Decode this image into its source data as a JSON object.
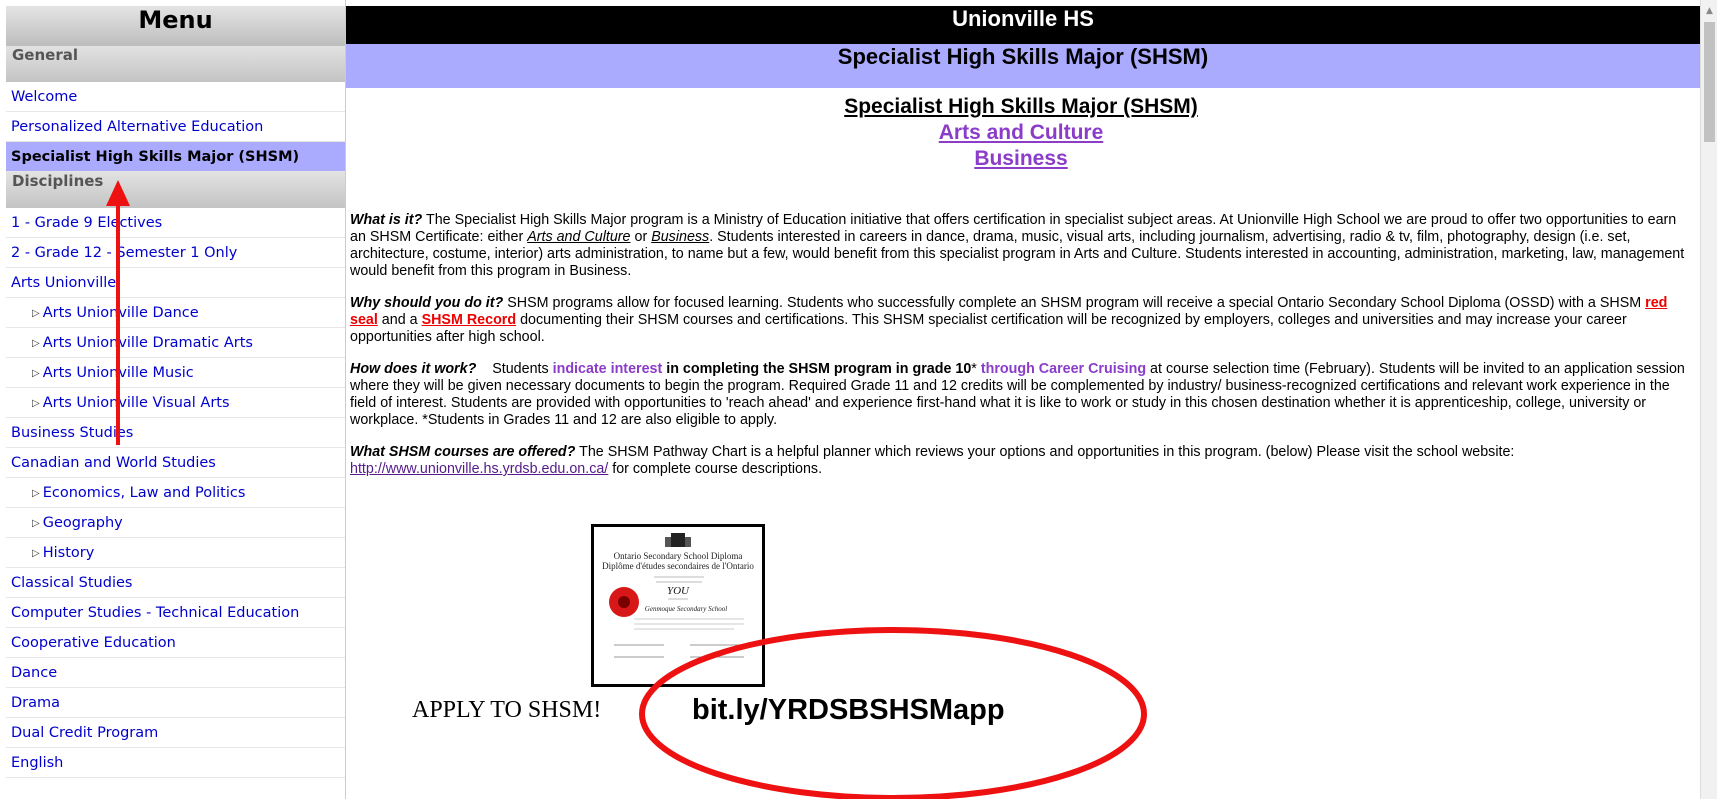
{
  "sidebar": {
    "title": "Menu",
    "general_heading": "General",
    "general_items": [
      {
        "label": "Welcome"
      },
      {
        "label": "Personalized Alternative Education"
      },
      {
        "label": "Specialist High Skills Major (SHSM)"
      }
    ],
    "disciplines_heading": "Disciplines",
    "discipline_items": [
      {
        "label": "1 - Grade 9 Electives"
      },
      {
        "label": "2 - Grade 12 - Semester 1 Only"
      },
      {
        "label": "Arts Unionville"
      },
      {
        "label": "Arts Unionville Dance"
      },
      {
        "label": "Arts Unionville Dramatic Arts"
      },
      {
        "label": "Arts Unionville Music"
      },
      {
        "label": "Arts Unionville Visual Arts"
      },
      {
        "label": "Business Studies"
      },
      {
        "label": "Canadian and World Studies"
      },
      {
        "label": "Economics, Law and Politics"
      },
      {
        "label": "Geography"
      },
      {
        "label": "History"
      },
      {
        "label": "Classical Studies"
      },
      {
        "label": "Computer Studies - Technical Education"
      },
      {
        "label": "Cooperative Education"
      },
      {
        "label": "Dance"
      },
      {
        "label": "Drama"
      },
      {
        "label": "Dual Credit Program"
      },
      {
        "label": "English"
      }
    ]
  },
  "header": {
    "school": "Unionville HS",
    "page_title": "Specialist High Skills Major (SHSM)"
  },
  "content": {
    "heading": "Specialist High Skills Major (SHSM)",
    "link_arts": "Arts and Culture",
    "link_business": "Business",
    "p1": {
      "q": "What is it?",
      "t1": " The Specialist High Skills Major program is a  Ministry of Education initiative that  offers certification in specialist subject areas. At Unionville High School we are proud to offer two opportunities to earn an SHSM Certificate:  either ",
      "l1": "Arts and Culture",
      "t2": " or ",
      "l2": "Business",
      "t3": ".  Students interested in careers in dance, drama, music, visual arts, including journalism, advertising, radio & tv, film, photography, design (i.e. set, architecture, costume, interior) arts administration, to name but a few,  would benefit from this specialist program in Arts and Culture.  Students interested in accounting, administration, marketing, law, management would benefit from this program in Business."
    },
    "p2": {
      "q": "Why should you do it?",
      "t1": " SHSM programs allow for focused learning.  Students who successfully complete an SHSM program will receive a special Ontario Secondary School Diploma (OSSD) with a SHSM ",
      "l1": "red seal",
      "t2": " and a ",
      "l2": "SHSM Record",
      "t3": " documenting their SHSM courses and certifications. This SHSM specialist certification will be recognized by employers, colleges and universities and may increase your career opportunities after high school."
    },
    "p3": {
      "q": "How does it work?",
      "t0": "    Students ",
      "h1": "indicate interest",
      "b1": " in completing the SHSM program in grade 10",
      "t1": "* ",
      "h2": "through Career Cruising",
      "t2": " at course selection time (February).  Students will be invited to an application session where they will be given necessary documents to begin the program.   Required Grade 11 and 12 credits will be complemented by industry/ business-recognized certifications and relevant work experience in the  field of interest. Students are provided with opportunities to 'reach ahead' and experience first-hand what it is like to work or study in this chosen destination whether it is apprenticeship, college, university or workplace.   *Students in Grades 11 and 12 are also eligible to apply."
    },
    "p4": {
      "q": "What SHSM courses are offered?",
      "t1": "  The SHSM Pathway Chart is a  helpful planner which  reviews your options and opportunities in this program. (below)  Please visit the school website:  ",
      "link": "http://www.unionville.hs.yrdsb.edu.on.ca/",
      "t2": "  for complete course descriptions."
    },
    "diploma": {
      "line1": "Ontario Secondary School Diploma",
      "line2": "Diplôme d'études secondaires de l'Ontario",
      "name": "YOU",
      "school": "Genmoque Secondary School"
    },
    "apply_label": "APPLY TO SHSM!",
    "apply_link": "bit.ly/YRDSBSHSMapp"
  },
  "colors": {
    "active_nav": "#aaaaff",
    "nav_link": "#0000cc",
    "annotation": "#ee1111",
    "purple_link": "#8b3cc9"
  }
}
